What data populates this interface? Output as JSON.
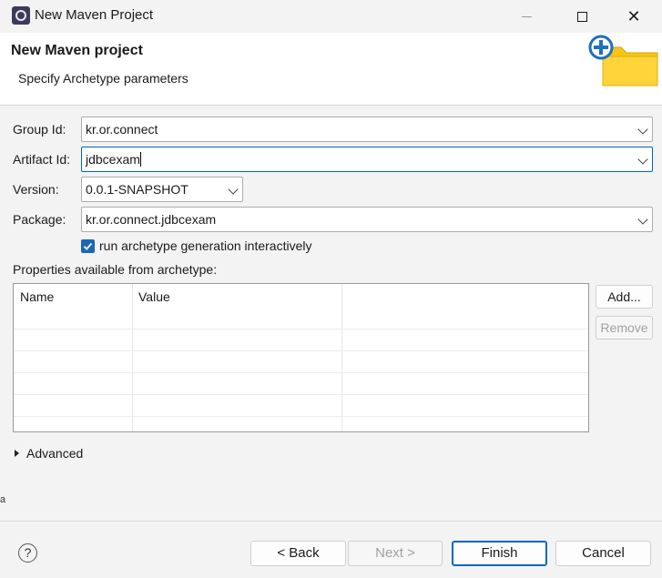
{
  "window": {
    "title": "New Maven Project",
    "close_glyph": "✕"
  },
  "banner": {
    "title": "New Maven project",
    "subtitle": "Specify Archetype parameters",
    "icon": "new-folder-icon"
  },
  "form": {
    "group_id": {
      "label": "Group Id:",
      "value": "kr.or.connect"
    },
    "artifact_id": {
      "label": "Artifact Id:",
      "value": "jdbcexam"
    },
    "version": {
      "label": "Version:",
      "value": "0.0.1-SNAPSHOT"
    },
    "package": {
      "label": "Package:",
      "value": "kr.or.connect.jdbcexam"
    },
    "interactive": {
      "label": "run archetype generation interactively",
      "checked": true
    }
  },
  "properties": {
    "label": "Properties available from archetype:",
    "columns": [
      "Name",
      "Value"
    ],
    "rows": [],
    "add_label": "Add...",
    "remove_label": "Remove"
  },
  "advanced": {
    "label": "Advanced"
  },
  "footer": {
    "help_glyph": "?",
    "back_label": "< Back",
    "next_label": "Next >",
    "finish_label": "Finish",
    "cancel_label": "Cancel"
  },
  "colors": {
    "accent": "#0067c0",
    "checkbox": "#1a66b8",
    "banner_bg": "#ffffff",
    "dialog_bg": "#f3f3f3"
  }
}
